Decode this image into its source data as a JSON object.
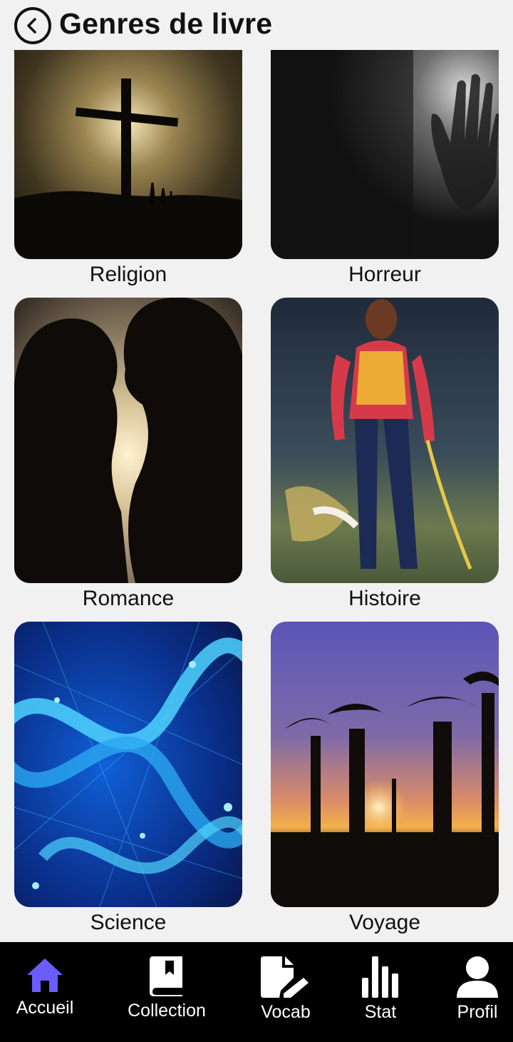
{
  "header": {
    "title": "Genres de livre"
  },
  "genres": [
    {
      "label": "Religion"
    },
    {
      "label": "Horreur"
    },
    {
      "label": "Romance"
    },
    {
      "label": "Histoire"
    },
    {
      "label": "Science"
    },
    {
      "label": "Voyage"
    }
  ],
  "nav": [
    {
      "label": "Accueil",
      "icon": "home-icon",
      "active": true
    },
    {
      "label": "Collection",
      "icon": "book-icon",
      "active": false
    },
    {
      "label": "Vocab",
      "icon": "edit-document-icon",
      "active": false
    },
    {
      "label": "Stat",
      "icon": "bar-chart-icon",
      "active": false
    },
    {
      "label": "Profil",
      "icon": "user-icon",
      "active": false
    }
  ],
  "colors": {
    "accent": "#6b5cff",
    "nav_background": "#000000",
    "page_background": "#f1f1f1"
  }
}
